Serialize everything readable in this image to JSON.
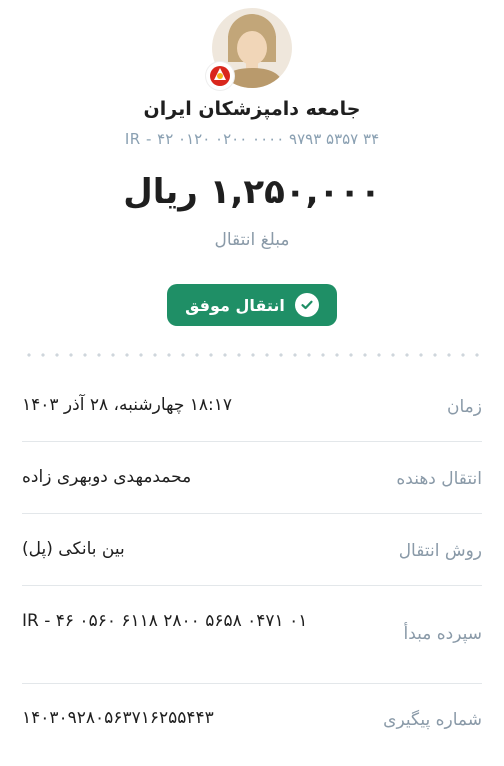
{
  "recipient": {
    "name": "جامعه دامپزشکان ایران",
    "iban": "IR - ۴۲ ۰۱۲۰ ۰۲۰۰ ۰۰۰۰ ۹۷۹۳ ۵۳۵۷ ۳۴",
    "avatar_icon": "person-avatar-icon",
    "bank_icon": "bank-mellat-logo-icon"
  },
  "amount": {
    "value": "۱,۲۵۰,۰۰۰ ریال",
    "label": "مبلغ انتقال"
  },
  "status": {
    "label": "انتقال موفق",
    "icon": "check-circle-icon",
    "color": "#1f8f66"
  },
  "details": [
    {
      "label": "زمان",
      "value": "۱۸:۱۷ چهارشنبه، ۲۸ آذر ۱۴۰۳"
    },
    {
      "label": "انتقال دهنده",
      "value": "محمدمهدی دوبهری زاده"
    },
    {
      "label": "روش انتقال",
      "value": "بین بانکی (پل)"
    },
    {
      "label": "سپرده مبدأ",
      "value": "IR - ۴۶ ۰۵۶۰ ۶۱۱۸ ۲۸۰۰ ۵۶۵۸ ۰۴۷۱ ۰۱"
    },
    {
      "label": "شماره پیگیری",
      "value": "۱۴۰۳۰۹۲۸۰۵۶۳۷۱۶۲۵۵۴۴۳"
    }
  ]
}
